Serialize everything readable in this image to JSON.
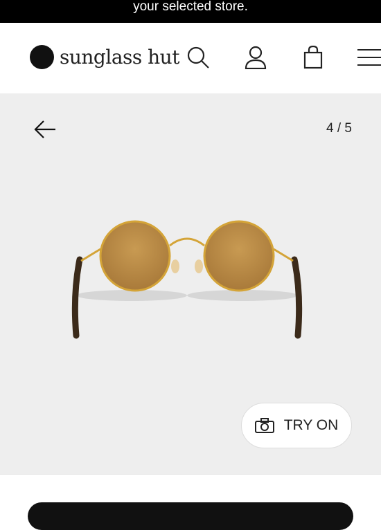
{
  "banner": {
    "text": "your selected store."
  },
  "header": {
    "logo_text": "sunglass hut",
    "icons": [
      "search-icon",
      "user-icon",
      "shopping-bag-icon",
      "menu-icon"
    ]
  },
  "gallery": {
    "counter": "4 / 5",
    "back_icon": "arrow-left-icon",
    "try_on_label": "TRY ON",
    "try_on_icon": "camera-icon"
  },
  "colors": {
    "background": "#eeeeee",
    "accent": "#111111"
  }
}
